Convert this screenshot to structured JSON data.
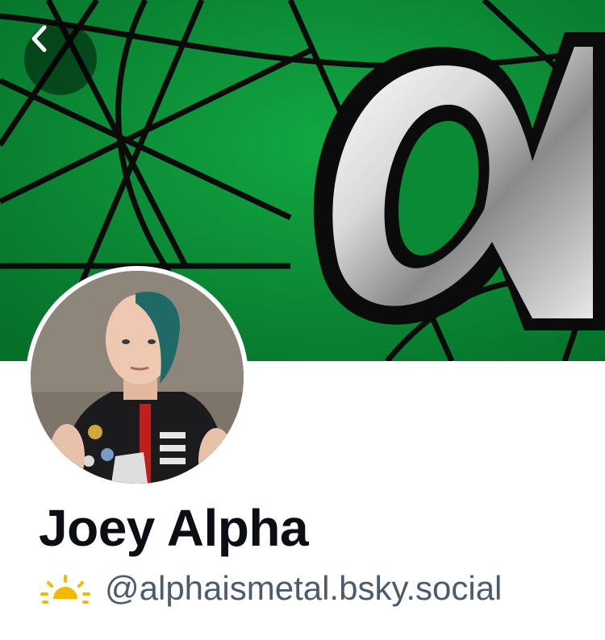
{
  "header": {
    "back_icon": "chevron-left-icon",
    "banner_color": "#0a8a35"
  },
  "profile": {
    "display_name": "Joey Alpha",
    "status_icon": "sunrise-icon",
    "handle": "@alphaismetal.bsky.social",
    "avatar_alt": "profile-photo"
  },
  "colors": {
    "name": "#0b0f14",
    "handle": "#4b5b6e",
    "status_icon": "#f5b800"
  }
}
